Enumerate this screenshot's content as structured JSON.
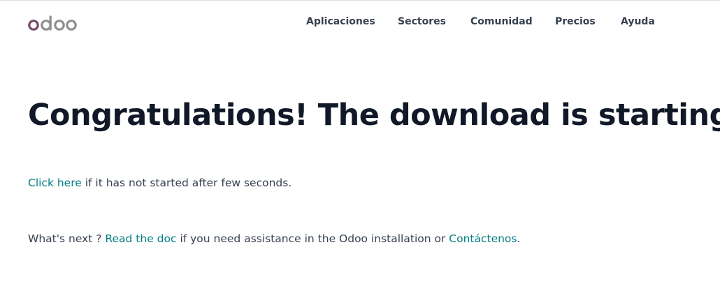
{
  "brand": {
    "logo_text": "odoo",
    "colors": {
      "logo_o_first": "#714b67",
      "logo_rest": "#8f8f8f",
      "link": "#017e84",
      "heading": "#111827",
      "body_text": "#374151"
    }
  },
  "nav": {
    "items": [
      {
        "label": "Aplicaciones"
      },
      {
        "label": "Sectores"
      },
      {
        "label": "Comunidad"
      },
      {
        "label": "Precios"
      },
      {
        "label": "Ayuda"
      }
    ]
  },
  "main": {
    "title": "Congratulations! The download is starting",
    "retry": {
      "link": "Click here",
      "text": " if it has not started after few seconds."
    },
    "next": {
      "prefix": "What's next ? ",
      "doc_link": "Read the doc",
      "middle": " if you need assistance in the Odoo installation or ",
      "contact_link": "Contáctenos",
      "suffix": "."
    }
  }
}
